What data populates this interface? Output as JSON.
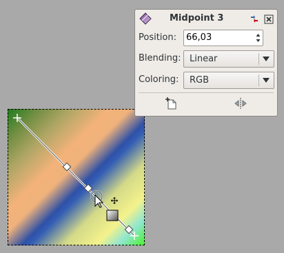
{
  "dialog": {
    "title": "Midpoint 3",
    "position_label": "Position:",
    "position_value": "66,03",
    "blending_label": "Blending:",
    "blending_value": "Linear",
    "coloring_label": "Coloring:",
    "coloring_value": "RGB"
  },
  "icons": {
    "dialog": "blend-tool-icon",
    "pin": "pin-icon",
    "close": "close-icon",
    "spin": "spin-arrows-icon",
    "combo": "chevron-down-icon",
    "new_midpoint": "new-midpoint-icon",
    "center_midpoint": "center-midpoint-icon",
    "move_cursor": "move-cursor-icon",
    "arrow_cursor": "arrow-cursor-icon"
  },
  "colors": {
    "canvas_bg": "#a9a9a9",
    "dialog_bg": "#efebe7",
    "text": "#2e3436"
  }
}
